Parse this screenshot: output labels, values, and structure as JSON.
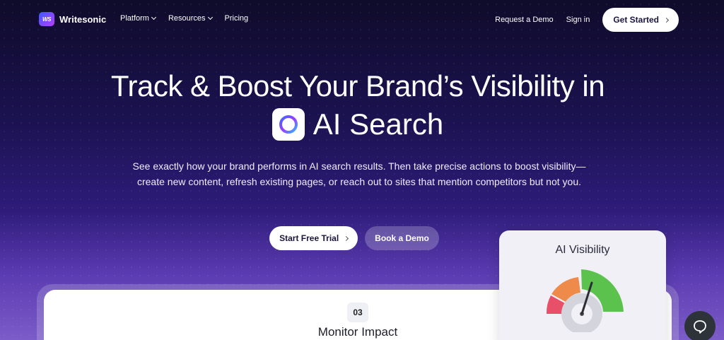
{
  "brand": {
    "name": "Writesonic",
    "mark": "WS"
  },
  "nav": {
    "menu": [
      {
        "label": "Platform",
        "dropdown": true
      },
      {
        "label": "Resources",
        "dropdown": true
      },
      {
        "label": "Pricing",
        "dropdown": false
      }
    ],
    "request_demo": "Request a Demo",
    "sign_in": "Sign in",
    "get_started": "Get Started"
  },
  "hero": {
    "headline_line1": "Track & Boost Your Brand’s Visibility in",
    "headline_line2": "AI Search",
    "subheading": "See exactly how your brand performs in AI search results. Then take precise actions to boost visibility—create new content, refresh existing pages, or reach out to sites that mention competitors but not you.",
    "primary_cta": "Start Free Trial",
    "secondary_cta": "Book a Demo"
  },
  "step_card": {
    "number": "03",
    "title": "Monitor Impact"
  },
  "visibility_card": {
    "title": "AI Visibility",
    "gauge_colors": {
      "red": "#e8506a",
      "orange": "#ee8b4a",
      "green": "#5cc24e",
      "hub": "#d4d4dc"
    }
  },
  "colors": {
    "bg_top": "#0f0b2a",
    "bg_bottom": "#7c5cc8",
    "accent": "#1b1440"
  },
  "icons": {
    "chevron": "chevron-down-icon",
    "arrow": "chevron-right-icon",
    "chat": "chat-bubble-icon",
    "ai_search": "ai-search-ring-icon"
  }
}
